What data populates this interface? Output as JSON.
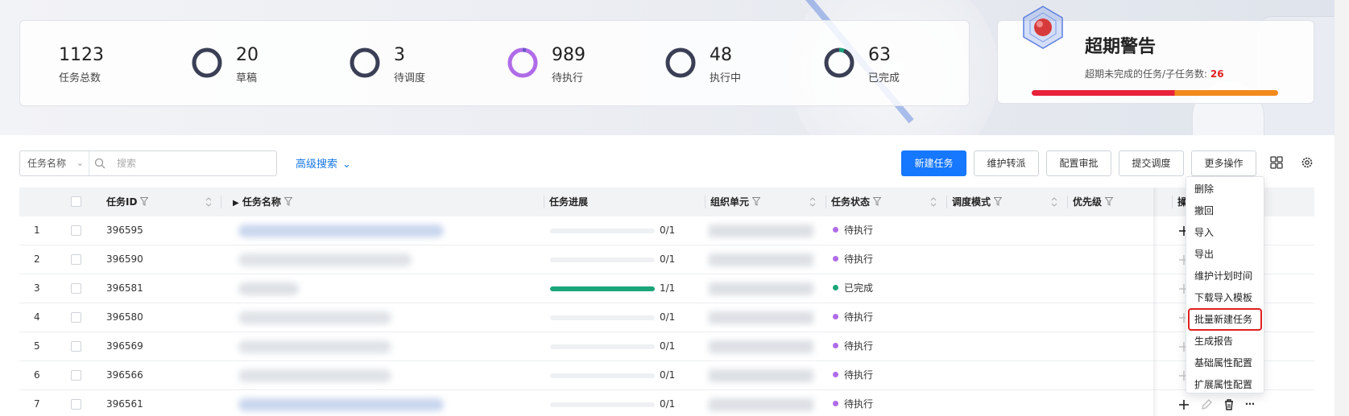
{
  "stats": [
    {
      "value": "1123",
      "label": "任务总数"
    },
    {
      "value": "20",
      "label": "草稿",
      "ring_color": "#3a3f55",
      "ring_fraction": 0.02
    },
    {
      "value": "3",
      "label": "待调度",
      "ring_color": "#3a3f55",
      "ring_fraction": 0.003
    },
    {
      "value": "989",
      "label": "待执行",
      "ring_color": "#b06ce8",
      "ring_fraction": 0.88
    },
    {
      "value": "48",
      "label": "执行中",
      "ring_color": "#3a3f55",
      "ring_fraction": 0.04
    },
    {
      "value": "63",
      "label": "已完成",
      "ring_color": "#3a3f55",
      "accent": "#1aa57a",
      "ring_fraction": 0.06
    }
  ],
  "alert": {
    "title": "超期警告",
    "subtitle": "超期未完成的任务/子任务数:",
    "count": "26",
    "bar_colors": [
      "#e8223a",
      "#f28a1c"
    ]
  },
  "toolbar": {
    "search_type": "任务名称",
    "search_placeholder": "搜索",
    "advanced_search": "高级搜索",
    "buttons": {
      "new_task": "新建任务",
      "maintain_transfer": "维护转派",
      "config_approve": "配置审批",
      "submit_schedule": "提交调度",
      "more_ops": "更多操作"
    }
  },
  "table": {
    "headers": {
      "task_id": "任务ID",
      "task_name": "任务名称",
      "progress": "任务进展",
      "org_unit": "组织单元",
      "status": "任务状态",
      "schedule_mode": "调度模式",
      "priority": "优先级",
      "ops": "操作"
    },
    "rows": [
      {
        "index": "1",
        "id": "396595",
        "progress_text": "0/1",
        "progress": 0,
        "status": "待执行",
        "status_color": "#b06ce8"
      },
      {
        "index": "2",
        "id": "396590",
        "progress_text": "0/1",
        "progress": 0,
        "status": "待执行",
        "status_color": "#b06ce8"
      },
      {
        "index": "3",
        "id": "396581",
        "progress_text": "1/1",
        "progress": 1,
        "status": "已完成",
        "status_color": "#1aa57a"
      },
      {
        "index": "4",
        "id": "396580",
        "progress_text": "0/1",
        "progress": 0,
        "status": "待执行",
        "status_color": "#b06ce8"
      },
      {
        "index": "5",
        "id": "396569",
        "progress_text": "0/1",
        "progress": 0,
        "status": "待执行",
        "status_color": "#b06ce8"
      },
      {
        "index": "6",
        "id": "396566",
        "progress_text": "0/1",
        "progress": 0,
        "status": "待执行",
        "status_color": "#b06ce8"
      },
      {
        "index": "7",
        "id": "396561",
        "progress_text": "0/1",
        "progress": 0,
        "status": "待执行",
        "status_color": "#b06ce8"
      }
    ]
  },
  "more_menu": {
    "items": [
      "删除",
      "撤回",
      "导入",
      "导出",
      "维护计划时间",
      "下载导入模板",
      "批量新建任务",
      "生成报告",
      "基础属性配置",
      "扩展属性配置"
    ],
    "highlighted": "批量新建任务"
  }
}
